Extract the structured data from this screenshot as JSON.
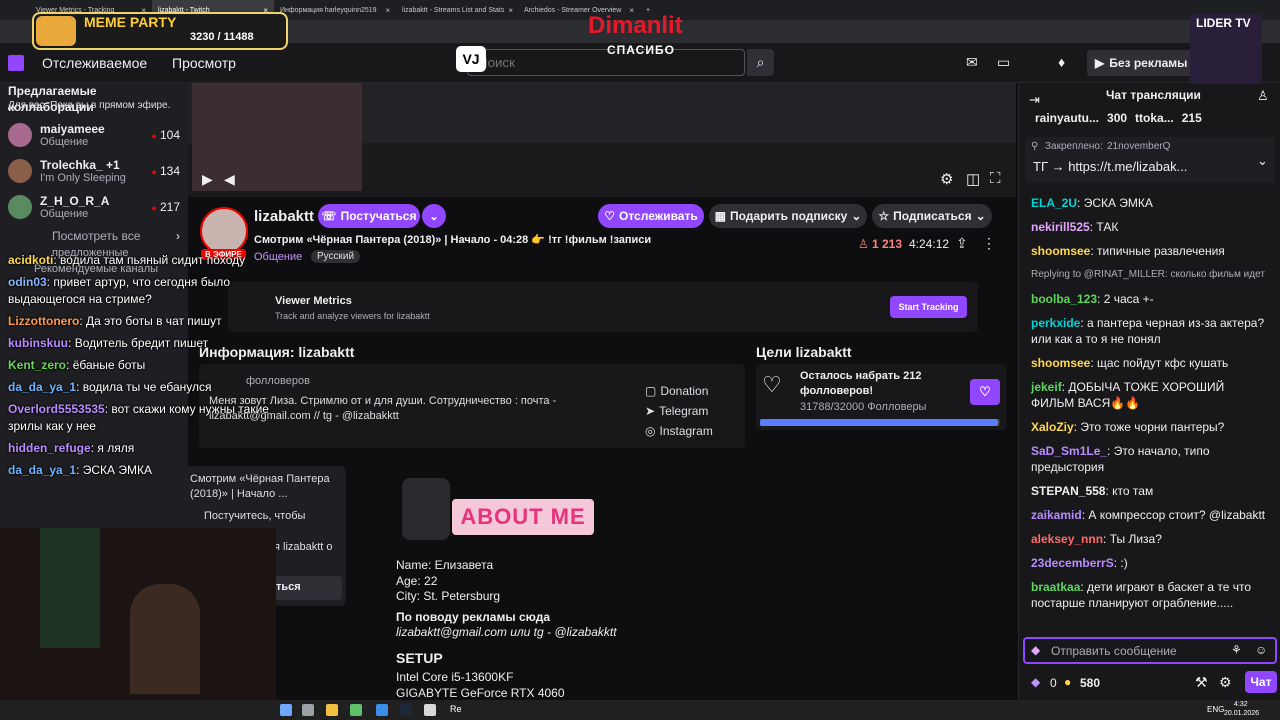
{
  "browser": {
    "tabs": [
      {
        "label": "Viewer Metrics - Tracking",
        "active": false
      },
      {
        "label": "lizabaktt - Twitch",
        "active": true
      },
      {
        "label": "Информация harleyquinn2519",
        "active": false
      },
      {
        "label": "lizabaktt - Streams List and Stats",
        "active": false
      },
      {
        "label": "Archiedos - Streamer Overview",
        "active": false
      }
    ],
    "new_tab": "+"
  },
  "overlay": {
    "meme_party": "MEME PARTY",
    "meme_count": "3230 / 11488",
    "dimanlit": "Dimanlit",
    "spasibo": "СПАСИБО",
    "vj": "VJ",
    "lider_tv": "LIDER TV"
  },
  "twitch_header": {
    "following": "Отслеживаемое",
    "browse": "Просмотр",
    "search_placeholder": "Поиск",
    "no_ads": "Без рекламы бесплатно"
  },
  "sidebar": {
    "section_title": "Предлагаемые коллаборации",
    "section_sub": "Для вас. Пока вы в прямом эфире.",
    "items": [
      {
        "name": "maiyameee",
        "category": "Общение",
        "count": "104"
      },
      {
        "name": "Trolechka_ +1",
        "category": "I'm Only Sleeping",
        "count": "134"
      },
      {
        "name": "Z_H_O_R_A",
        "category": "Общение",
        "count": "217"
      }
    ],
    "see_all": "Посмотреть все",
    "suggested": "предложенные",
    "recommended": "Рекомендуемые каналы"
  },
  "channel": {
    "name": "lizabaktt",
    "live_badge": "В ЭФИРЕ",
    "knock_button": "Постучаться",
    "follow_button": "Отслеживать",
    "gift_button": "Подарить подписку",
    "subscribe_button": "Подписаться",
    "title": "Смотрим «Чёрная Пантера (2018)» | Начало - 04:28 👉 !тг !фильм !записи",
    "category": "Общение",
    "language": "Русский",
    "viewers": "1 213",
    "uptime": "4:24:12"
  },
  "extension": {
    "title": "Viewer Metrics",
    "subtitle": "Track and analyze viewers for lizabaktt",
    "button": "Start Tracking"
  },
  "about": {
    "heading": "Информация: lizabaktt",
    "followers": "фолловеров",
    "bio": "Меня зовут Лиза. Стримлю от и для души. Сотрудничество : почта - lizabaktt@gmail.com // tg - @lizabakktt",
    "links": [
      "Donation",
      "Telegram",
      "Instagram"
    ],
    "banner": "ABOUT ME",
    "lines": [
      "Name: Елизавета",
      "Age: 22",
      "City: St. Petersburg"
    ],
    "ads_title": "По поводу рекламы сюда",
    "ads_text": "lizabaktt@gmail.com или tg - @lizabakktt",
    "setup_title": "SETUP",
    "setup_lines": [
      "Intel Core i5-13600KF",
      "GIGABYTE GeForce RTX 4060"
    ]
  },
  "goals": {
    "heading": "Цели lizabaktt",
    "title": "Осталось набрать 212 фолловеров!",
    "progress_text": "31788/32000 Фолловеры",
    "progress": 0.993
  },
  "popup": {
    "title": "Смотрим «Чёрная Пантера (2018)» | Начало ...",
    "knock": "Постучитесь, чтобы",
    "sub": "я lizabaktt о",
    "btn": "ться"
  },
  "overlay_chat": [
    {
      "user": "acidkoti",
      "text": "водила там пьяный сидит походу",
      "color": "#ffd84d"
    },
    {
      "user": "odin03",
      "text": "привет артур, что сегодня было выдающегося на стриме?",
      "color": "#8ab4ff"
    },
    {
      "user": "Lizzottonero",
      "text": "Да это боты в чат пишут",
      "color": "#ff9a4d"
    },
    {
      "user": "kubinskuu",
      "text": "Водитель бредит пишет",
      "color": "#b98cff"
    },
    {
      "user": "Kent_zero",
      "text": "ёбаные боты",
      "color": "#6dd35a"
    },
    {
      "user": "da_da_ya_1",
      "text": "водила ты че ебанулся",
      "color": "#6fb4ff"
    },
    {
      "user": "Overlord5553535",
      "text": "вот скажи кому нужны такие зрилы как у нее",
      "color": "#b98cff"
    },
    {
      "user": "hidden_refuge",
      "text": "я ляля",
      "color": "#b98cff"
    },
    {
      "user": "da_da_ya_1",
      "text": "ЭСКА ЭМКА",
      "color": "#6fb4ff"
    }
  ],
  "stream_chat": {
    "header": "Чат трансляции",
    "top": [
      {
        "name": "rainyautu...",
        "count": "300"
      },
      {
        "name": "ttoka...",
        "count": "215"
      }
    ],
    "pinned_label": "Закреплено:",
    "pinned_by": "21novemberQ",
    "pinned_text": "ТГ → https://t.me/lizabak...",
    "messages": [
      {
        "user": "ELA_2U",
        "text": "ЭСКА ЭМКА",
        "color": "#00d6d6"
      },
      {
        "user": "nekirill525",
        "text": "ТАК",
        "color": "#e3a6ff"
      },
      {
        "user": "shoomsee",
        "text": "типичные развлечения",
        "color": "#ffd84d"
      },
      {
        "user": "",
        "text": "Replying to @RINAT_MILLER: сколько фильм идет",
        "color": "#adadb8"
      },
      {
        "user": "boolba_123",
        "text": "2 часа +-",
        "color": "#5cd65c"
      },
      {
        "user": "perkxide",
        "text": "а пантера черная из-за актера? или как а то я не понял",
        "color": "#00d6d6"
      },
      {
        "user": "shoomsee",
        "text": "щас пойдут кфс кушать",
        "color": "#ffd84d"
      },
      {
        "user": "jekeif",
        "text": "ДОБЫЧА ТОЖЕ ХОРОШИЙ ФИЛЬМ ВАСЯ🔥🔥",
        "color": "#5cd65c"
      },
      {
        "user": "XaloZiy",
        "text": "Это тоже чорни пантеры?",
        "color": "#ffd84d"
      },
      {
        "user": "SaD_Sm1Le_",
        "text": "Это начало, типо предыстория",
        "color": "#b98cff"
      },
      {
        "user": "STEPAN_558",
        "text": "кто там",
        "color": "#efeff1"
      },
      {
        "user": "zaikamid",
        "text": "А компрессор стоит? @lizabaktt",
        "color": "#b98cff"
      },
      {
        "user": "aleksey_nnn",
        "text": "Ты Лиза?",
        "color": "#ff6b6b"
      },
      {
        "user": "23decemberrS",
        "text": ":)",
        "color": "#b98cff"
      },
      {
        "user": "braatkaa",
        "text": "дети играют в баскет а те что постарше планируют ограбление.....",
        "color": "#5cd65c"
      }
    ],
    "input_placeholder": "Отправить сообщение",
    "points": "580",
    "bits": "0",
    "chat_button": "Чат"
  },
  "taskbar": {
    "time": "4:32",
    "date": "20.01.2026",
    "lang": "ENG"
  }
}
